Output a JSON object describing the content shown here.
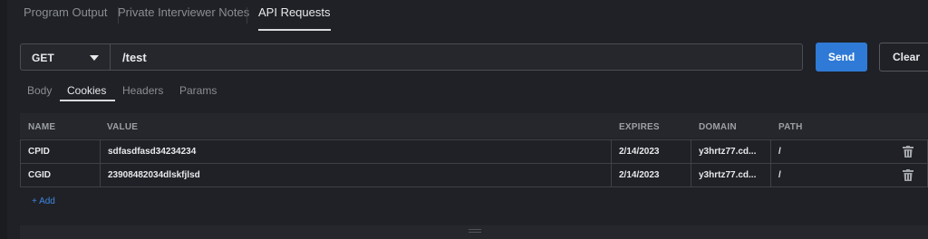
{
  "top_tabs": [
    {
      "label": "Program Output"
    },
    {
      "label": "Private Interviewer Notes"
    },
    {
      "label": "API Requests",
      "active": true
    }
  ],
  "request": {
    "method": "GET",
    "url": "/test",
    "send_label": "Send",
    "clear_label": "Clear"
  },
  "sub_tabs": [
    {
      "label": "Body"
    },
    {
      "label": "Cookies",
      "active": true
    },
    {
      "label": "Headers"
    },
    {
      "label": "Params"
    }
  ],
  "table": {
    "columns": [
      "NAME",
      "VALUE",
      "EXPIRES",
      "DOMAIN",
      "PATH"
    ],
    "rows": [
      {
        "name": "CPID",
        "value": "sdfasdfasd34234234",
        "expires": "2/14/2023",
        "domain": "y3hrtz77.cd...",
        "path": "/"
      },
      {
        "name": "CGID",
        "value": "23908482034dlskfjlsd",
        "expires": "2/14/2023",
        "domain": "y3hrtz77.cd...",
        "path": "/"
      }
    ],
    "add_label": "+ Add"
  },
  "colors": {
    "background": "#1f2126",
    "accent": "#2f7ad6",
    "link": "#3f86e0"
  },
  "icons": [
    "chevron-down-icon",
    "trash-icon",
    "drag-handle-icon"
  ]
}
